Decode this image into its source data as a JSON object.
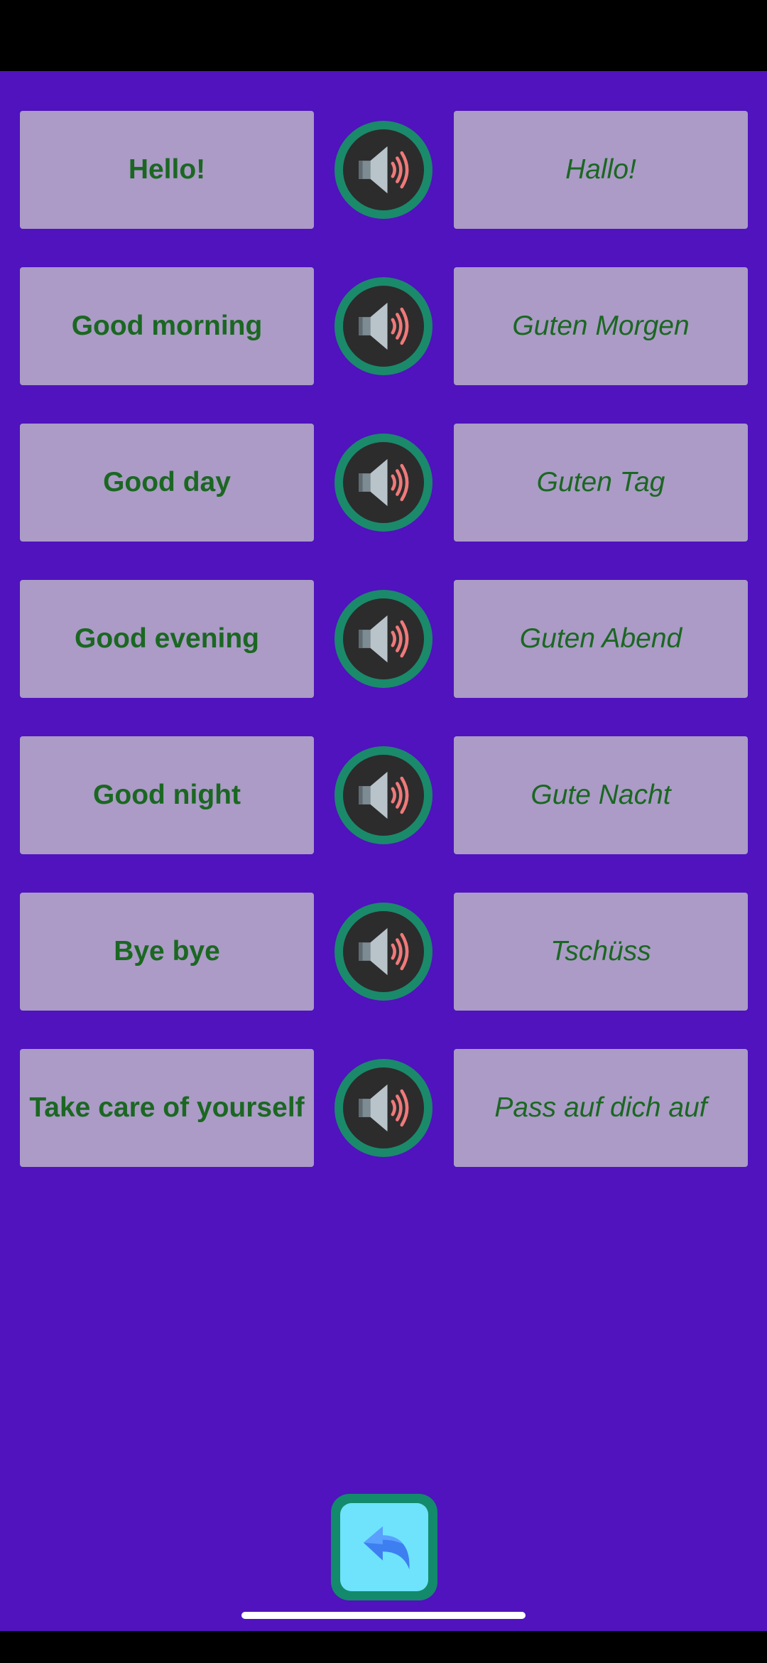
{
  "colors": {
    "background": "#5013bd",
    "card": "#ab9bc6",
    "card_text": "#1b6722",
    "speaker_ring": "#1a8a6b",
    "speaker_core": "#2c2c2c",
    "back_ring": "#138a6b",
    "back_core": "#6ee3fb"
  },
  "phrases": [
    {
      "english": "Hello!",
      "german": "Hallo!"
    },
    {
      "english": "Good morning",
      "german": "Guten Morgen"
    },
    {
      "english": "Good day",
      "german": "Guten Tag"
    },
    {
      "english": "Good evening",
      "german": "Guten Abend"
    },
    {
      "english": "Good night",
      "german": "Gute Nacht"
    },
    {
      "english": "Bye bye",
      "german": "Tschüss"
    },
    {
      "english": "Take care of yourself",
      "german": "Pass auf dich auf"
    }
  ],
  "icons": {
    "speaker": "speaker-volume-icon",
    "back": "reply-arrow-icon"
  }
}
